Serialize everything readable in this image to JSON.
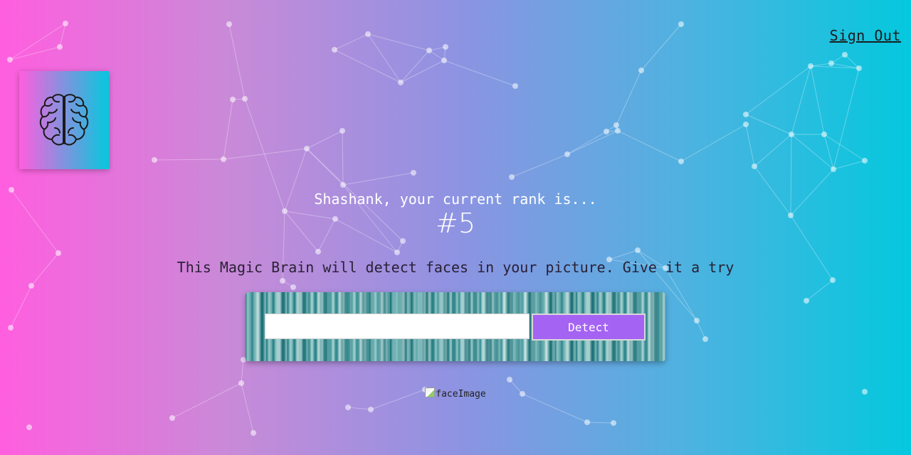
{
  "nav": {
    "sign_out_label": "Sign Out"
  },
  "logo": {
    "icon": "brain-icon"
  },
  "rank": {
    "message": "Shashank, your current rank is...",
    "value": "#5"
  },
  "intro": {
    "text": "This Magic Brain will detect faces in your picture. Give it a try"
  },
  "image_form": {
    "input_value": "",
    "input_placeholder": "",
    "detect_label": "Detect"
  },
  "result": {
    "image_alt": "faceImage"
  },
  "colors": {
    "gradient_start": "#ff5edf",
    "gradient_end": "#04c8de",
    "detect_button": "#a463f2",
    "panel_teal": "#1d7b80"
  }
}
